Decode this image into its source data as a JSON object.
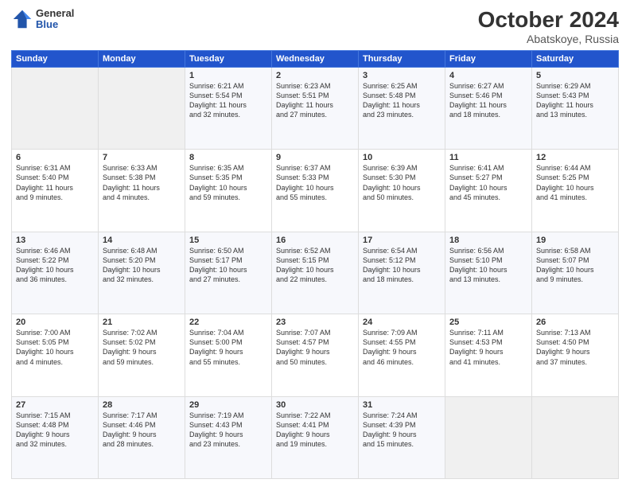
{
  "header": {
    "logo_general": "General",
    "logo_blue": "Blue",
    "month": "October 2024",
    "location": "Abatskoye, Russia"
  },
  "weekdays": [
    "Sunday",
    "Monday",
    "Tuesday",
    "Wednesday",
    "Thursday",
    "Friday",
    "Saturday"
  ],
  "weeks": [
    [
      {
        "day": "",
        "info": ""
      },
      {
        "day": "",
        "info": ""
      },
      {
        "day": "1",
        "info": "Sunrise: 6:21 AM\nSunset: 5:54 PM\nDaylight: 11 hours\nand 32 minutes."
      },
      {
        "day": "2",
        "info": "Sunrise: 6:23 AM\nSunset: 5:51 PM\nDaylight: 11 hours\nand 27 minutes."
      },
      {
        "day": "3",
        "info": "Sunrise: 6:25 AM\nSunset: 5:48 PM\nDaylight: 11 hours\nand 23 minutes."
      },
      {
        "day": "4",
        "info": "Sunrise: 6:27 AM\nSunset: 5:46 PM\nDaylight: 11 hours\nand 18 minutes."
      },
      {
        "day": "5",
        "info": "Sunrise: 6:29 AM\nSunset: 5:43 PM\nDaylight: 11 hours\nand 13 minutes."
      }
    ],
    [
      {
        "day": "6",
        "info": "Sunrise: 6:31 AM\nSunset: 5:40 PM\nDaylight: 11 hours\nand 9 minutes."
      },
      {
        "day": "7",
        "info": "Sunrise: 6:33 AM\nSunset: 5:38 PM\nDaylight: 11 hours\nand 4 minutes."
      },
      {
        "day": "8",
        "info": "Sunrise: 6:35 AM\nSunset: 5:35 PM\nDaylight: 10 hours\nand 59 minutes."
      },
      {
        "day": "9",
        "info": "Sunrise: 6:37 AM\nSunset: 5:33 PM\nDaylight: 10 hours\nand 55 minutes."
      },
      {
        "day": "10",
        "info": "Sunrise: 6:39 AM\nSunset: 5:30 PM\nDaylight: 10 hours\nand 50 minutes."
      },
      {
        "day": "11",
        "info": "Sunrise: 6:41 AM\nSunset: 5:27 PM\nDaylight: 10 hours\nand 45 minutes."
      },
      {
        "day": "12",
        "info": "Sunrise: 6:44 AM\nSunset: 5:25 PM\nDaylight: 10 hours\nand 41 minutes."
      }
    ],
    [
      {
        "day": "13",
        "info": "Sunrise: 6:46 AM\nSunset: 5:22 PM\nDaylight: 10 hours\nand 36 minutes."
      },
      {
        "day": "14",
        "info": "Sunrise: 6:48 AM\nSunset: 5:20 PM\nDaylight: 10 hours\nand 32 minutes."
      },
      {
        "day": "15",
        "info": "Sunrise: 6:50 AM\nSunset: 5:17 PM\nDaylight: 10 hours\nand 27 minutes."
      },
      {
        "day": "16",
        "info": "Sunrise: 6:52 AM\nSunset: 5:15 PM\nDaylight: 10 hours\nand 22 minutes."
      },
      {
        "day": "17",
        "info": "Sunrise: 6:54 AM\nSunset: 5:12 PM\nDaylight: 10 hours\nand 18 minutes."
      },
      {
        "day": "18",
        "info": "Sunrise: 6:56 AM\nSunset: 5:10 PM\nDaylight: 10 hours\nand 13 minutes."
      },
      {
        "day": "19",
        "info": "Sunrise: 6:58 AM\nSunset: 5:07 PM\nDaylight: 10 hours\nand 9 minutes."
      }
    ],
    [
      {
        "day": "20",
        "info": "Sunrise: 7:00 AM\nSunset: 5:05 PM\nDaylight: 10 hours\nand 4 minutes."
      },
      {
        "day": "21",
        "info": "Sunrise: 7:02 AM\nSunset: 5:02 PM\nDaylight: 9 hours\nand 59 minutes."
      },
      {
        "day": "22",
        "info": "Sunrise: 7:04 AM\nSunset: 5:00 PM\nDaylight: 9 hours\nand 55 minutes."
      },
      {
        "day": "23",
        "info": "Sunrise: 7:07 AM\nSunset: 4:57 PM\nDaylight: 9 hours\nand 50 minutes."
      },
      {
        "day": "24",
        "info": "Sunrise: 7:09 AM\nSunset: 4:55 PM\nDaylight: 9 hours\nand 46 minutes."
      },
      {
        "day": "25",
        "info": "Sunrise: 7:11 AM\nSunset: 4:53 PM\nDaylight: 9 hours\nand 41 minutes."
      },
      {
        "day": "26",
        "info": "Sunrise: 7:13 AM\nSunset: 4:50 PM\nDaylight: 9 hours\nand 37 minutes."
      }
    ],
    [
      {
        "day": "27",
        "info": "Sunrise: 7:15 AM\nSunset: 4:48 PM\nDaylight: 9 hours\nand 32 minutes."
      },
      {
        "day": "28",
        "info": "Sunrise: 7:17 AM\nSunset: 4:46 PM\nDaylight: 9 hours\nand 28 minutes."
      },
      {
        "day": "29",
        "info": "Sunrise: 7:19 AM\nSunset: 4:43 PM\nDaylight: 9 hours\nand 23 minutes."
      },
      {
        "day": "30",
        "info": "Sunrise: 7:22 AM\nSunset: 4:41 PM\nDaylight: 9 hours\nand 19 minutes."
      },
      {
        "day": "31",
        "info": "Sunrise: 7:24 AM\nSunset: 4:39 PM\nDaylight: 9 hours\nand 15 minutes."
      },
      {
        "day": "",
        "info": ""
      },
      {
        "day": "",
        "info": ""
      }
    ]
  ]
}
